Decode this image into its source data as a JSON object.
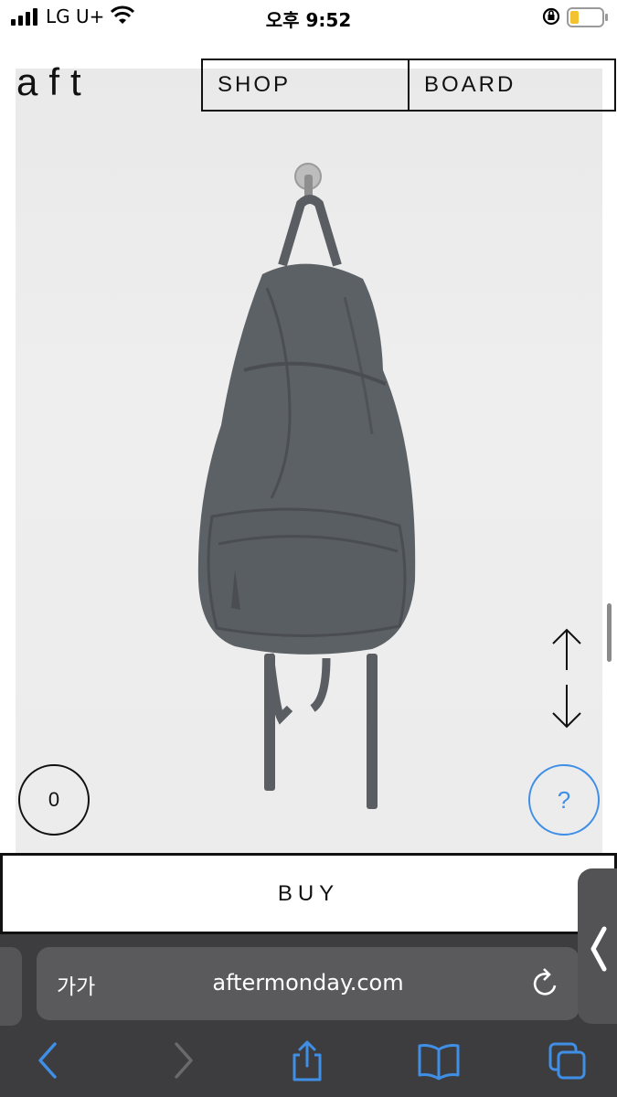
{
  "status_bar": {
    "carrier": "LG U+",
    "time": "오후 9:52",
    "battery_color": "#f2c230"
  },
  "header": {
    "logo": "aft",
    "nav": [
      "SHOP",
      "BOARD"
    ]
  },
  "product": {
    "image_desc_icon": "backpack-image"
  },
  "cart": {
    "count": "0"
  },
  "help": {
    "label": "?"
  },
  "buy": {
    "label": "BUY"
  },
  "browser": {
    "text_size_label": "가가",
    "url": "aftermonday.com"
  },
  "colors": {
    "accent_blue": "#3f8fe6",
    "safari_bg": "#3d3d3f",
    "backpack": "#5c6166"
  }
}
